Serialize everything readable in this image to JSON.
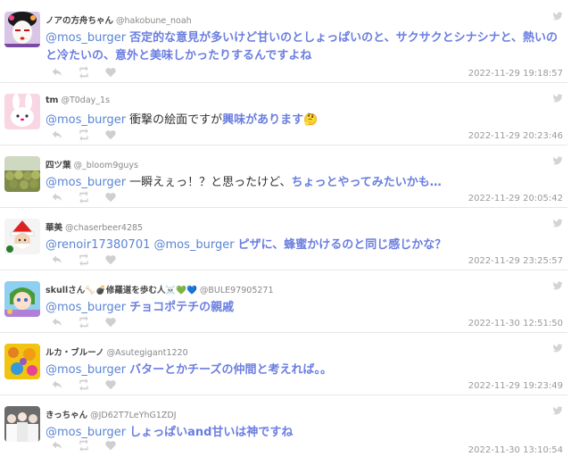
{
  "tweets": [
    {
      "name": "ノアの方舟ちゃん",
      "handle": "@hakobune_noah",
      "mention": "@mos_burger",
      "plain": "",
      "strong": "否定的な意見が多いけど甘いのとしょっぱいのと、サクサクとシナシナと、熱いのと冷たいの、意外と美味しかったりするんですよね",
      "date": "2022-11-29 19:18:57",
      "avatar": "avatar-maiko"
    },
    {
      "name": "tm",
      "handle": "@T0day_1s",
      "mention": "@mos_burger",
      "plain": "衝撃の絵面ですが",
      "strong": "興味があります🤔",
      "date": "2022-11-29 20:23:46",
      "avatar": "avatar-pink-rabbit"
    },
    {
      "name": "四ツ葉",
      "handle": "@_bloom9guys",
      "mention": "@mos_burger",
      "plain": "一瞬えぇっ！？と思ったけど、",
      "strong": "ちょっとやってみたいかも…",
      "date": "2022-11-29 20:05:42",
      "avatar": "avatar-field"
    },
    {
      "name": "華美",
      "handle": "@chaserbeer4285",
      "mention": "@renoir17380701 @mos_burger",
      "plain": "",
      "strong": "ピザに、蜂蜜かけるのと同じ感じかな？",
      "date": "2022-11-29 23:25:57",
      "avatar": "avatar-santa"
    },
    {
      "name": "skullさん🦴💣修羅道を歩む人☠️💚💙",
      "handle": "@BULE97905271",
      "mention": "@mos_burger",
      "plain": "",
      "strong": "チョコポテチの親戚",
      "date": "2022-11-30 12:51:50",
      "avatar": "avatar-anime"
    },
    {
      "name": "ルカ・ブルーノ",
      "handle": "@Asutegigant1220",
      "mention": "@mos_burger",
      "plain": "",
      "strong": "バターとかチーズの仲間と考えれば。。",
      "date": "2022-11-29 19:23:49",
      "avatar": "avatar-flowers"
    },
    {
      "name": "きっちゃん",
      "handle": "@JD62T7LeYhG1ZDJ",
      "mention": "@mos_burger",
      "plain": "",
      "strong": "しょっぱいand甘いは神ですね",
      "date": "2022-11-30 13:10:54",
      "avatar": "avatar-group-photo"
    }
  ],
  "icons": {
    "reply": "reply-icon",
    "retweet": "retweet-icon",
    "like": "heart-icon",
    "source": "twitter-bird-icon"
  },
  "colors": {
    "mention": "#5a84d4",
    "highlight": "#6a7ee0",
    "date": "#9a9a9a",
    "icon": "#cfcfcf"
  }
}
